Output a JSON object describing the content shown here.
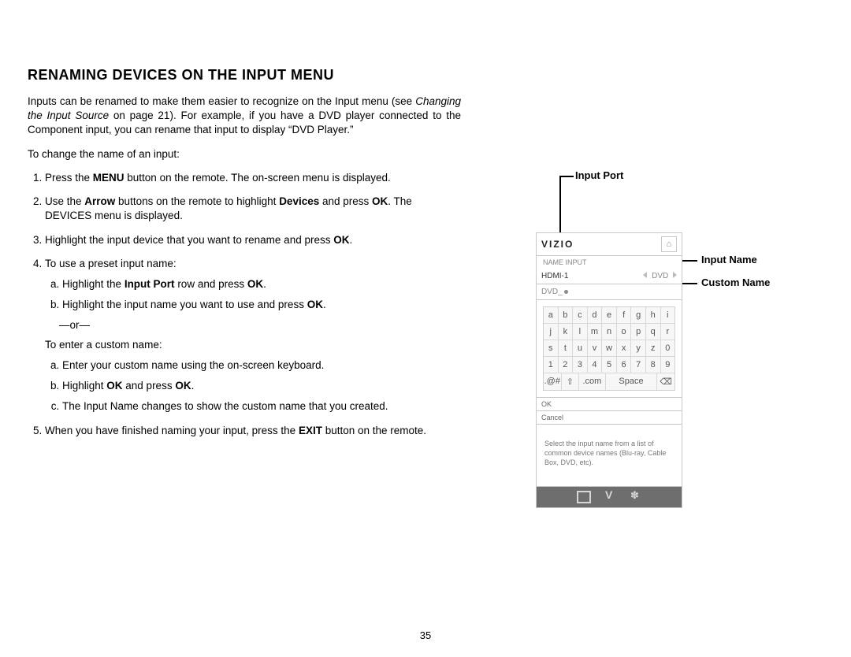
{
  "title": "RENAMING DEVICES ON THE INPUT MENU",
  "intro_a": "Inputs can be renamed to make them easier to recognize on the Input menu (see ",
  "intro_ref": "Changing the Input Source",
  "intro_b": " on page 21). For example, if you have a DVD player connected to the Component input, you can rename that input to display “DVD Player.”",
  "lead": "To change the name of an input:",
  "steps": {
    "s1a": "Press the ",
    "s1b": "MENU",
    "s1c": " button on the remote. The on-screen menu is displayed.",
    "s2a": "Use the ",
    "s2b": "Arrow",
    "s2c": " buttons on the remote to highlight ",
    "s2d": "Devices",
    "s2e": " and press ",
    "s2f": "OK",
    "s2g": ". The DEVICES menu is displayed.",
    "s3a": "Highlight the input device that you want to rename and press ",
    "s3b": "OK",
    "s3c": ".",
    "s4": "To use a preset input name:",
    "s4a1": "Highlight the ",
    "s4a2": "Input Port",
    "s4a3": " row and press ",
    "s4a4": "OK",
    "s4a5": ".",
    "s4b1": "Highlight the input name you want to use and press ",
    "s4b2": "OK",
    "s4b3": ".",
    "or": "—or—",
    "custom_lead": "To enter a custom name:",
    "ca": "Enter your custom name using the on-screen keyboard.",
    "cb1": "Highlight ",
    "cb2": "OK",
    "cb3": " and press ",
    "cb4": "OK",
    "cb5": ".",
    "cc": "The Input Name changes to show the custom name that you created.",
    "s5a": "When you have finished naming your input, press the ",
    "s5b": "EXIT",
    "s5c": " button on the remote."
  },
  "screen": {
    "brand": "VIZIO",
    "breadcrumb": "NAME INPUT",
    "port_label": "HDMI-1",
    "port_value": "DVD",
    "custom_value": "DVD_",
    "kb_rows": [
      [
        "a",
        "b",
        "c",
        "d",
        "e",
        "f",
        "g",
        "h",
        "i"
      ],
      [
        "j",
        "k",
        "l",
        "m",
        "n",
        "o",
        "p",
        "q",
        "r"
      ],
      [
        "s",
        "t",
        "u",
        "v",
        "w",
        "x",
        "y",
        "z",
        "0"
      ],
      [
        "1",
        "2",
        "3",
        "4",
        "5",
        "6",
        "7",
        "8",
        "9"
      ]
    ],
    "kb_last": {
      "sym": ".@#",
      "shift": "⇧",
      "com": ".com",
      "space": "Space",
      "del": "⌫"
    },
    "ok": "OK",
    "cancel": "Cancel",
    "hint": "Select the input name from a list of common device names (Blu-ray, Cable Box, DVD, etc)."
  },
  "callouts": {
    "input_port": "Input Port",
    "input_name": "Input Name",
    "custom_name": "Custom Name"
  },
  "page_number": "35"
}
